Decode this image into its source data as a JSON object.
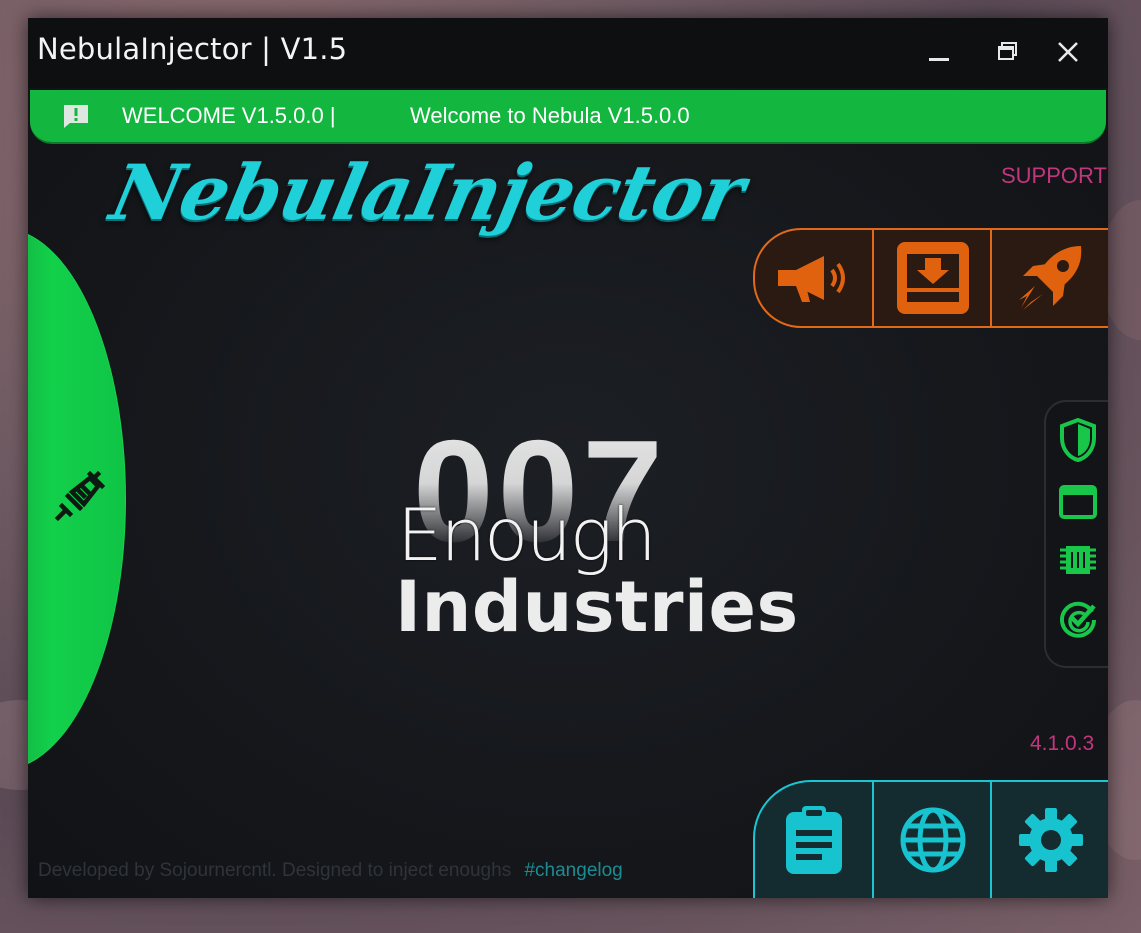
{
  "window": {
    "title": "NebulaInjector | V1.5"
  },
  "banner": {
    "title": "WELCOME V1.5.0.0 |",
    "message": "Welcome to Nebula V1.5.0.0"
  },
  "header": {
    "logo": "NebulaInjector",
    "support_label": "SUPPORT"
  },
  "center_logo": {
    "number": "007",
    "line1": "Enough",
    "line2": "Industries"
  },
  "version": "4.1.0.3",
  "footer": {
    "text": "Developed by Sojournercntl. Designed to inject enoughs",
    "changelog": "#changelog"
  },
  "colors": {
    "green_accent": "#13b63f",
    "orange_accent": "#e06a1a",
    "teal_accent": "#19c6d2",
    "pink_text": "#c2367e",
    "logo_cyan": "#1fd0d8"
  },
  "icons": {
    "banner": "alert-message-icon",
    "side": "syringe-icon",
    "orange": [
      "megaphone-icon",
      "download-tray-icon",
      "rocket-icon"
    ],
    "right_panel": [
      "shield-icon",
      "window-icon",
      "chip-icon",
      "check-circle-icon"
    ],
    "teal": [
      "clipboard-icon",
      "globe-icon",
      "gear-icon"
    ]
  }
}
